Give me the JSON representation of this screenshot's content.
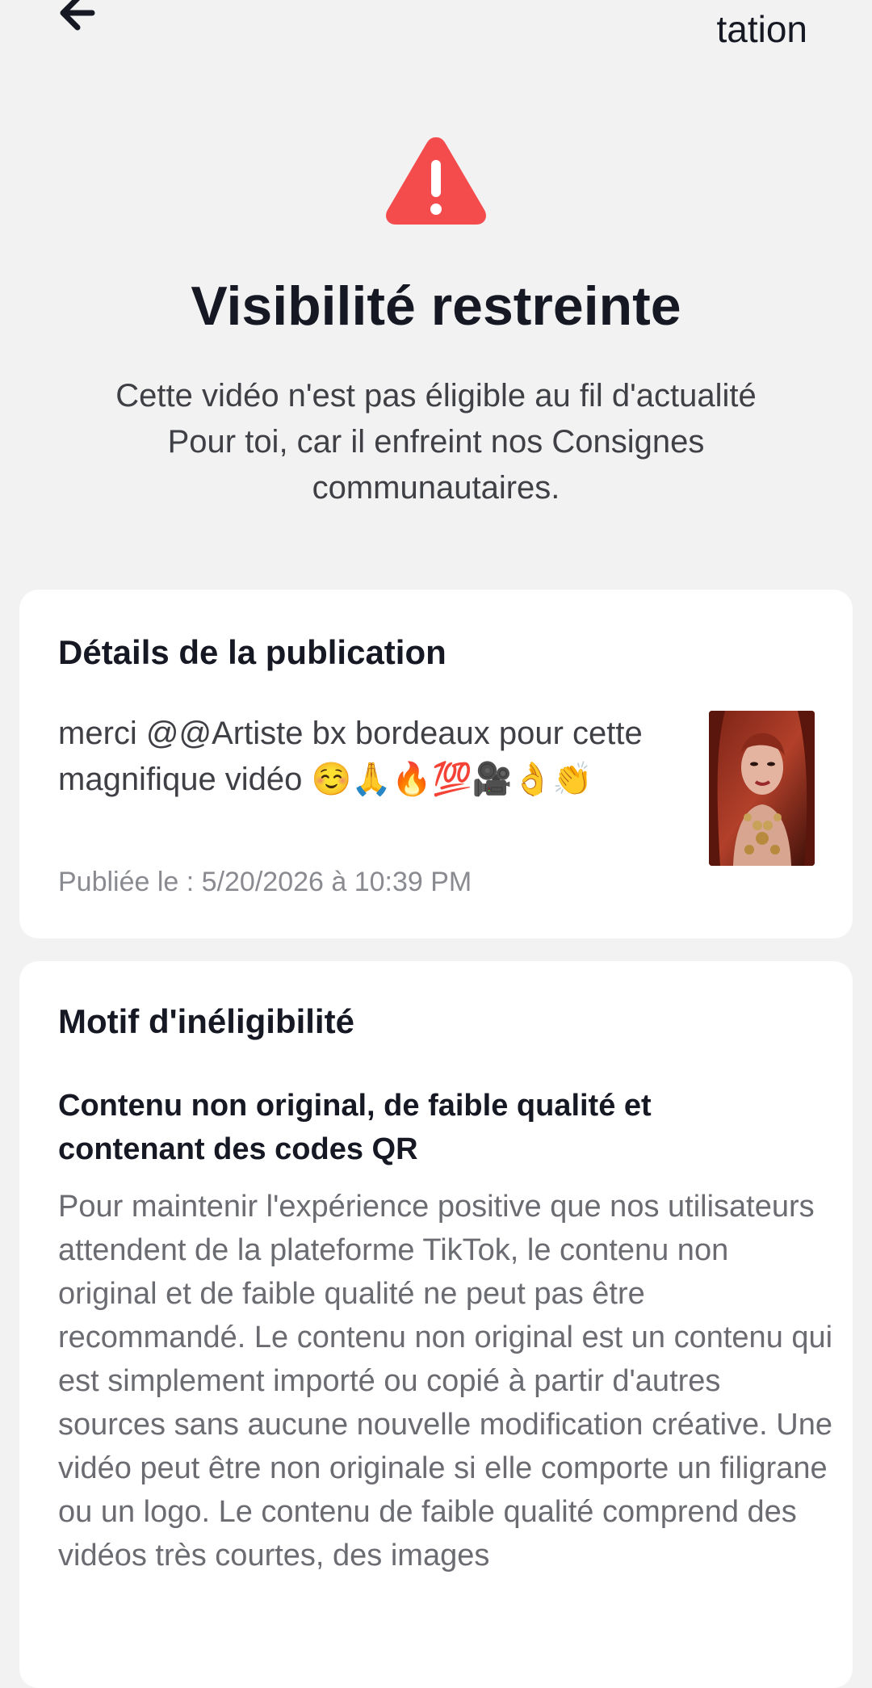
{
  "header": {
    "back_icon": "arrow-left-icon",
    "right_text": "tation"
  },
  "hero": {
    "icon": "warning-triangle-icon",
    "icon_color": "#f44c4c",
    "title": "Visibilité restreinte",
    "subtitle": "Cette vidéo n'est pas éligible au fil d'actualité Pour toi, car il enfreint nos Consignes communautaires."
  },
  "details": {
    "heading": "Détails de la publication",
    "caption": "merci @@Artiste bx bordeaux  pour cette magnifique vidéo ☺️🙏🔥💯🎥👌👏",
    "published": "Publiée le : 5/20/2026 à 10:39 PM",
    "thumbnail_alt": "video-thumbnail"
  },
  "reason": {
    "heading": "Motif d'inéligibilité",
    "title": "Contenu non original, de faible qualité et contenant des codes QR",
    "body": "Pour maintenir l'expérience positive que nos utilisateurs attendent de la plateforme TikTok, le contenu non original et de faible qualité ne peut pas être recommandé. Le contenu non original est un contenu qui est simplement importé ou copié à partir d'autres sources sans aucune nouvelle modification créative. Une vidéo peut être non originale si elle comporte un filigrane ou un logo. Le contenu de faible qualité comprend des vidéos très courtes, des images"
  }
}
